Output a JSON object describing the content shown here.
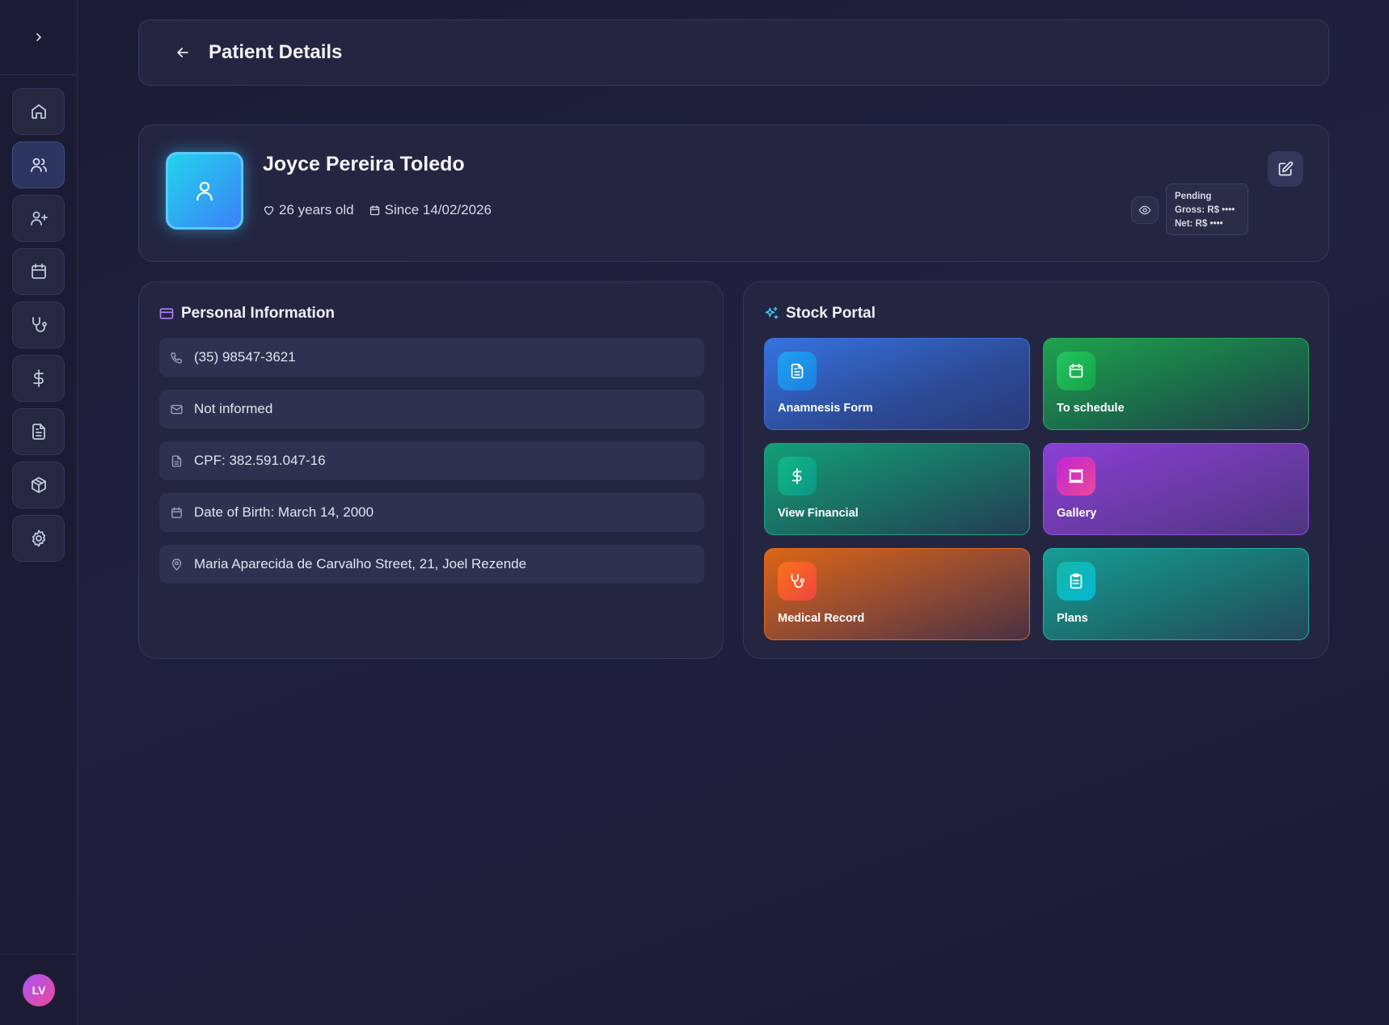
{
  "header": {
    "title": "Patient Details"
  },
  "patient": {
    "name": "Joyce Pereira Toledo",
    "age": "26 years old",
    "since": "Since 14/02/2026",
    "financial": {
      "status": "Pending",
      "gross": "Gross: R$ ••••",
      "net": "Net: R$ ••••"
    }
  },
  "personal_info": {
    "title": "Personal Information",
    "phone": "(35) 98547-3621",
    "email": "Not informed",
    "cpf": "CPF: 382.591.047-16",
    "dob": "Date of Birth: March 14, 2000",
    "address": "Maria Aparecida de Carvalho Street, 21, Joel Rezende"
  },
  "stock_portal": {
    "title": "Stock Portal",
    "tiles": [
      {
        "label": "Anamnesis Form",
        "icon": "document-icon"
      },
      {
        "label": "To schedule",
        "icon": "calendar-icon"
      },
      {
        "label": "View Financial",
        "icon": "dollar-icon"
      },
      {
        "label": "Gallery",
        "icon": "gallery-icon"
      },
      {
        "label": "Medical Record",
        "icon": "stethoscope-icon"
      },
      {
        "label": "Plans",
        "icon": "clipboard-icon"
      }
    ]
  },
  "sidebar": {
    "items": [
      {
        "icon": "home-icon"
      },
      {
        "icon": "users-icon",
        "active": true
      },
      {
        "icon": "user-plus-icon"
      },
      {
        "icon": "calendar-icon"
      },
      {
        "icon": "stethoscope-icon"
      },
      {
        "icon": "dollar-icon"
      },
      {
        "icon": "document-icon"
      },
      {
        "icon": "box-icon"
      },
      {
        "icon": "gear-icon"
      }
    ],
    "user_initials": "LV"
  },
  "colors": {
    "background": "#1f203c",
    "accent": "#3b82f6"
  }
}
